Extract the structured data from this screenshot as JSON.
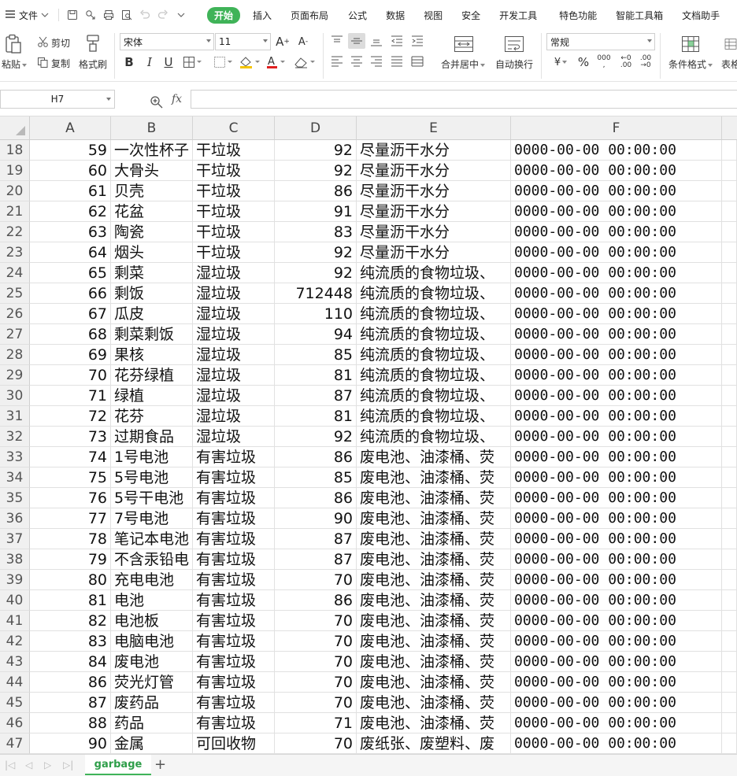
{
  "menubar": {
    "file_label": "文件",
    "tabs": [
      "开始",
      "插入",
      "页面布局",
      "公式",
      "数据",
      "视图",
      "安全",
      "开发工具",
      "特色功能",
      "智能工具箱",
      "文档助手"
    ],
    "active_tab": "开始",
    "accent_color": "#3fb358"
  },
  "ribbon": {
    "paste_label": "粘贴",
    "cut_label": "剪切",
    "copy_label": "复制",
    "format_painter_label": "格式刷",
    "font_name": "宋体",
    "font_size": "11",
    "merge_center_label": "合并居中",
    "wrap_text_label": "自动换行",
    "number_format": "常规",
    "conditional_format_label": "条件格式",
    "table_style_label": "表格"
  },
  "formula_bar": {
    "cell_reference": "H7",
    "fx_label": "fx",
    "formula_value": ""
  },
  "grid": {
    "columns": [
      "A",
      "B",
      "C",
      "D",
      "E",
      "F"
    ],
    "rows": [
      {
        "n": "18",
        "a": "59",
        "b": "一次性杯子",
        "c": "干垃圾",
        "d": "92",
        "e": "尽量沥干水分",
        "f": "0000-00-00 00:00:00"
      },
      {
        "n": "19",
        "a": "60",
        "b": "大骨头",
        "c": "干垃圾",
        "d": "92",
        "e": "尽量沥干水分",
        "f": "0000-00-00 00:00:00"
      },
      {
        "n": "20",
        "a": "61",
        "b": "贝壳",
        "c": "干垃圾",
        "d": "86",
        "e": "尽量沥干水分",
        "f": "0000-00-00 00:00:00"
      },
      {
        "n": "21",
        "a": "62",
        "b": "花盆",
        "c": "干垃圾",
        "d": "91",
        "e": "尽量沥干水分",
        "f": "0000-00-00 00:00:00"
      },
      {
        "n": "22",
        "a": "63",
        "b": "陶瓷",
        "c": "干垃圾",
        "d": "83",
        "e": "尽量沥干水分",
        "f": "0000-00-00 00:00:00"
      },
      {
        "n": "23",
        "a": "64",
        "b": "烟头",
        "c": "干垃圾",
        "d": "92",
        "e": "尽量沥干水分",
        "f": "0000-00-00 00:00:00"
      },
      {
        "n": "24",
        "a": "65",
        "b": "剩菜",
        "c": "湿垃圾",
        "d": "92",
        "e": "纯流质的食物垃圾、",
        "f": "0000-00-00 00:00:00"
      },
      {
        "n": "25",
        "a": "66",
        "b": "剩饭",
        "c": "湿垃圾",
        "d": "712448",
        "e": "纯流质的食物垃圾、",
        "f": "0000-00-00 00:00:00"
      },
      {
        "n": "26",
        "a": "67",
        "b": "瓜皮",
        "c": "湿垃圾",
        "d": "110",
        "e": "纯流质的食物垃圾、",
        "f": "0000-00-00 00:00:00"
      },
      {
        "n": "27",
        "a": "68",
        "b": "剩菜剩饭",
        "c": "湿垃圾",
        "d": "94",
        "e": "纯流质的食物垃圾、",
        "f": "0000-00-00 00:00:00"
      },
      {
        "n": "28",
        "a": "69",
        "b": "果核",
        "c": "湿垃圾",
        "d": "85",
        "e": "纯流质的食物垃圾、",
        "f": "0000-00-00 00:00:00"
      },
      {
        "n": "29",
        "a": "70",
        "b": "花芬绿植",
        "c": "湿垃圾",
        "d": "81",
        "e": "纯流质的食物垃圾、",
        "f": "0000-00-00 00:00:00"
      },
      {
        "n": "30",
        "a": "71",
        "b": "绿植",
        "c": "湿垃圾",
        "d": "87",
        "e": "纯流质的食物垃圾、",
        "f": "0000-00-00 00:00:00"
      },
      {
        "n": "31",
        "a": "72",
        "b": "花芬",
        "c": "湿垃圾",
        "d": "81",
        "e": "纯流质的食物垃圾、",
        "f": "0000-00-00 00:00:00"
      },
      {
        "n": "32",
        "a": "73",
        "b": "过期食品",
        "c": "湿垃圾",
        "d": "92",
        "e": "纯流质的食物垃圾、",
        "f": "0000-00-00 00:00:00"
      },
      {
        "n": "33",
        "a": "74",
        "b": "1号电池",
        "c": "有害垃圾",
        "d": "86",
        "e": "废电池、油漆桶、荧",
        "f": "0000-00-00 00:00:00"
      },
      {
        "n": "34",
        "a": "75",
        "b": "5号电池",
        "c": "有害垃圾",
        "d": "85",
        "e": "废电池、油漆桶、荧",
        "f": "0000-00-00 00:00:00"
      },
      {
        "n": "35",
        "a": "76",
        "b": "5号干电池",
        "c": "有害垃圾",
        "d": "86",
        "e": "废电池、油漆桶、荧",
        "f": "0000-00-00 00:00:00"
      },
      {
        "n": "36",
        "a": "77",
        "b": "7号电池",
        "c": "有害垃圾",
        "d": "90",
        "e": "废电池、油漆桶、荧",
        "f": "0000-00-00 00:00:00"
      },
      {
        "n": "37",
        "a": "78",
        "b": "笔记本电池",
        "c": "有害垃圾",
        "d": "87",
        "e": "废电池、油漆桶、荧",
        "f": "0000-00-00 00:00:00"
      },
      {
        "n": "38",
        "a": "79",
        "b": "不含汞铅电",
        "c": "有害垃圾",
        "d": "87",
        "e": "废电池、油漆桶、荧",
        "f": "0000-00-00 00:00:00"
      },
      {
        "n": "39",
        "a": "80",
        "b": "充电电池",
        "c": "有害垃圾",
        "d": "70",
        "e": "废电池、油漆桶、荧",
        "f": "0000-00-00 00:00:00"
      },
      {
        "n": "40",
        "a": "81",
        "b": "电池",
        "c": "有害垃圾",
        "d": "86",
        "e": "废电池、油漆桶、荧",
        "f": "0000-00-00 00:00:00"
      },
      {
        "n": "41",
        "a": "82",
        "b": "电池板",
        "c": "有害垃圾",
        "d": "70",
        "e": "废电池、油漆桶、荧",
        "f": "0000-00-00 00:00:00"
      },
      {
        "n": "42",
        "a": "83",
        "b": "电脑电池",
        "c": "有害垃圾",
        "d": "70",
        "e": "废电池、油漆桶、荧",
        "f": "0000-00-00 00:00:00"
      },
      {
        "n": "43",
        "a": "84",
        "b": "废电池",
        "c": "有害垃圾",
        "d": "70",
        "e": "废电池、油漆桶、荧",
        "f": "0000-00-00 00:00:00"
      },
      {
        "n": "44",
        "a": "86",
        "b": "荧光灯管",
        "c": "有害垃圾",
        "d": "70",
        "e": "废电池、油漆桶、荧",
        "f": "0000-00-00 00:00:00"
      },
      {
        "n": "45",
        "a": "87",
        "b": "废药品",
        "c": "有害垃圾",
        "d": "70",
        "e": "废电池、油漆桶、荧",
        "f": "0000-00-00 00:00:00"
      },
      {
        "n": "46",
        "a": "88",
        "b": "药品",
        "c": "有害垃圾",
        "d": "71",
        "e": "废电池、油漆桶、荧",
        "f": "0000-00-00 00:00:00"
      },
      {
        "n": "47",
        "a": "90",
        "b": "金属",
        "c": "可回收物",
        "d": "70",
        "e": "废纸张、废塑料、废",
        "f": "0000-00-00 00:00:00"
      }
    ]
  },
  "sheets": {
    "tabs": [
      "garbage"
    ],
    "active": "garbage",
    "add_icon": "plus-icon"
  }
}
